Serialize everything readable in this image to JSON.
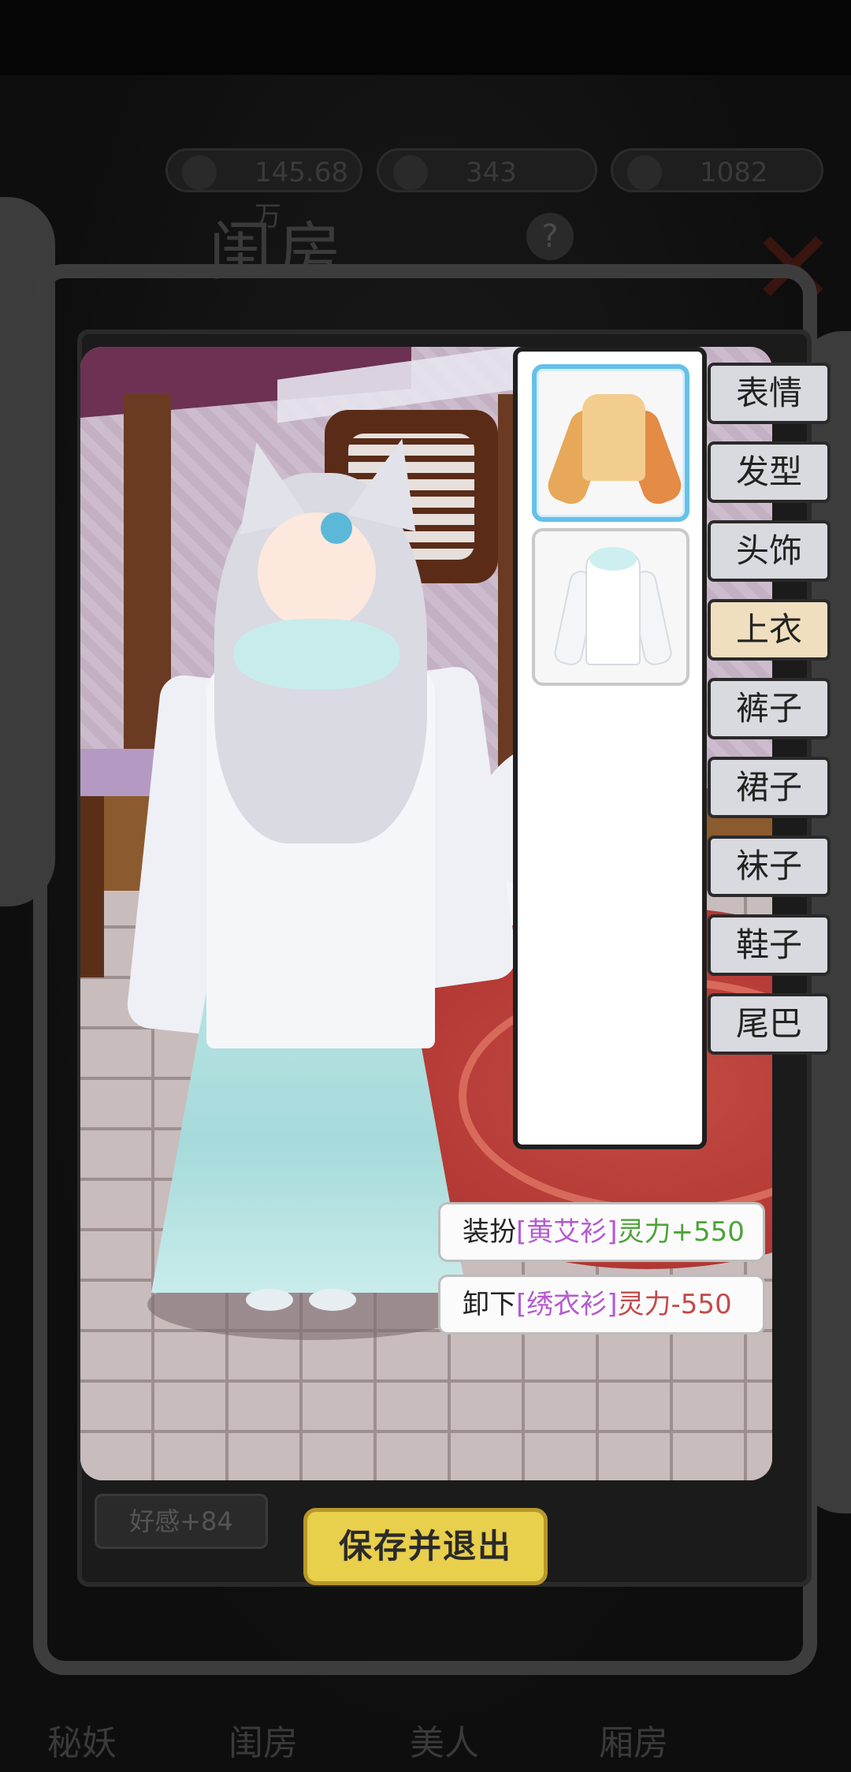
{
  "hud": {
    "resources": [
      {
        "icon": "gold-coin-icon",
        "value": "145.68万"
      },
      {
        "icon": "food-icon",
        "value": "343"
      },
      {
        "icon": "gem-icon",
        "value": "1082"
      }
    ]
  },
  "header": {
    "title": "闺房",
    "help_icon": "question-icon",
    "close_icon": "close-x-icon"
  },
  "items": [
    {
      "name": "黄艾衫",
      "selected": true,
      "icon": "yellow-top-garment-icon"
    },
    {
      "name": "绣衣衫",
      "selected": false,
      "icon": "white-robe-garment-icon"
    }
  ],
  "tabs": [
    {
      "label": "表情"
    },
    {
      "label": "发型"
    },
    {
      "label": "头饰"
    },
    {
      "label": "上衣",
      "active": true
    },
    {
      "label": "裤子"
    },
    {
      "label": "裙子"
    },
    {
      "label": "袜子"
    },
    {
      "label": "鞋子"
    },
    {
      "label": "尾巴"
    }
  ],
  "actions": {
    "equip": {
      "prefix": "装扮",
      "bracket_open": "[",
      "item": "黄艾衫",
      "bracket_close": "]",
      "stat": "灵力+550",
      "item_color": "#b45ad2",
      "stat_color": "#4ea33a"
    },
    "unequip": {
      "prefix": "卸下",
      "bracket_open": "[",
      "item": "绣衣衫",
      "bracket_close": "]",
      "stat": "灵力-550",
      "item_color": "#b45ad2",
      "stat_color": "#c34a4a"
    }
  },
  "affection": "好感+84",
  "save_button": "保存并退出",
  "bottom_nav": [
    "秘妖",
    "闺房",
    "美人",
    "厢房"
  ]
}
